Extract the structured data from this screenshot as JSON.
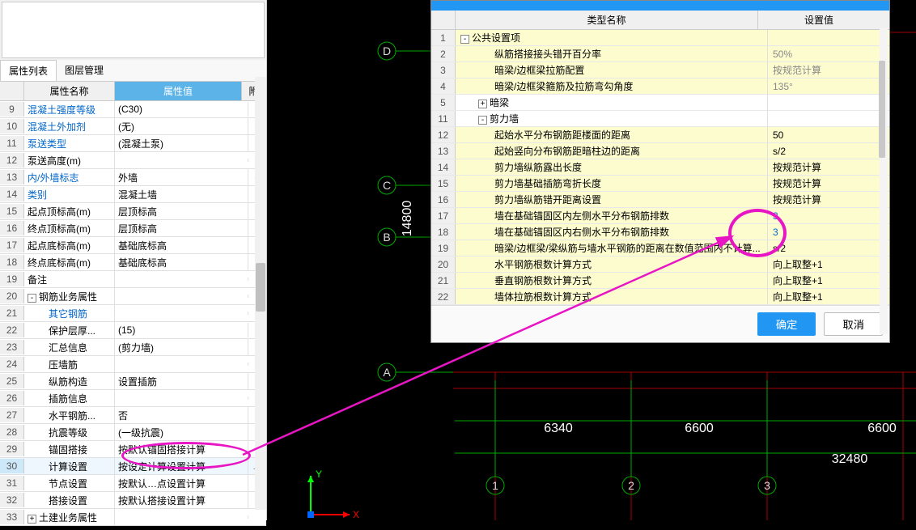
{
  "leftPanel": {
    "tabs": {
      "a": "属性列表",
      "b": "图层管理"
    },
    "header": {
      "name": "属性名称",
      "val": "属性值",
      "ext": "附"
    },
    "rows": [
      {
        "n": "9",
        "name": "混凝土强度等级",
        "val": "(C30)",
        "link": true,
        "ind": 0,
        "ext": "("
      },
      {
        "n": "10",
        "name": "混凝土外加剂",
        "val": "(无)",
        "link": true,
        "ind": 0,
        "ext": ""
      },
      {
        "n": "11",
        "name": "泵送类型",
        "val": "(混凝土泵)",
        "link": true,
        "ind": 0,
        "ext": ""
      },
      {
        "n": "12",
        "name": "泵送高度(m)",
        "val": "",
        "link": false,
        "ind": 0,
        "ext": ""
      },
      {
        "n": "13",
        "name": "内/外墙标志",
        "val": "外墙",
        "link": true,
        "ind": 0,
        "ext": "✓"
      },
      {
        "n": "14",
        "name": "类别",
        "val": "混凝土墙",
        "link": true,
        "ind": 0,
        "ext": "("
      },
      {
        "n": "15",
        "name": "起点顶标高(m)",
        "val": "层顶标高",
        "link": false,
        "ind": 0,
        "ext": "("
      },
      {
        "n": "16",
        "name": "终点顶标高(m)",
        "val": "层顶标高",
        "link": false,
        "ind": 0,
        "ext": "("
      },
      {
        "n": "17",
        "name": "起点底标高(m)",
        "val": "基础底标高",
        "link": false,
        "ind": 0,
        "ext": "("
      },
      {
        "n": "18",
        "name": "终点底标高(m)",
        "val": "基础底标高",
        "link": false,
        "ind": 0,
        "ext": "("
      },
      {
        "n": "19",
        "name": "备注",
        "val": "",
        "link": false,
        "ind": 0,
        "ext": "("
      },
      {
        "n": "20",
        "name": "钢筋业务属性",
        "val": "",
        "link": false,
        "ind": 0,
        "ext": "",
        "exp": "-"
      },
      {
        "n": "21",
        "name": "其它钢筋",
        "val": "",
        "link": true,
        "ind": 2,
        "ext": ""
      },
      {
        "n": "22",
        "name": "保护层厚...",
        "val": "(15)",
        "link": false,
        "ind": 2,
        "ext": "("
      },
      {
        "n": "23",
        "name": "汇总信息",
        "val": "(剪力墙)",
        "link": false,
        "ind": 2,
        "ext": "("
      },
      {
        "n": "24",
        "name": "压墙筋",
        "val": "",
        "link": false,
        "ind": 2,
        "ext": "("
      },
      {
        "n": "25",
        "name": "纵筋构造",
        "val": "设置插筋",
        "link": false,
        "ind": 2,
        "ext": "("
      },
      {
        "n": "26",
        "name": "插筋信息",
        "val": "",
        "link": false,
        "ind": 2,
        "ext": "("
      },
      {
        "n": "27",
        "name": "水平钢筋...",
        "val": "否",
        "link": false,
        "ind": 2,
        "ext": "("
      },
      {
        "n": "28",
        "name": "抗震等级",
        "val": "(一级抗震)",
        "link": false,
        "ind": 2,
        "ext": "("
      },
      {
        "n": "29",
        "name": "锚固搭接",
        "val": "按默认锚固搭接计算",
        "link": false,
        "ind": 2,
        "ext": "("
      },
      {
        "n": "30",
        "name": "计算设置",
        "val": "按设定计算设置计算",
        "link": false,
        "ind": 2,
        "ext": "…",
        "sel": true
      },
      {
        "n": "31",
        "name": "节点设置",
        "val": "按默认…点设置计算",
        "link": false,
        "ind": 2,
        "ext": "("
      },
      {
        "n": "32",
        "name": "搭接设置",
        "val": "按默认搭接设置计算",
        "link": false,
        "ind": 2,
        "ext": "("
      },
      {
        "n": "33",
        "name": "土建业务属性",
        "val": "",
        "link": false,
        "ind": 0,
        "ext": "",
        "exp": "+"
      }
    ]
  },
  "dialog": {
    "header": {
      "c1": "类型名称",
      "c2": "设置值"
    },
    "rows": [
      {
        "n": "1",
        "t": "公共设置项",
        "v": "",
        "exp": "-",
        "ind": 0,
        "w": false
      },
      {
        "n": "2",
        "t": "纵筋搭接接头错开百分率",
        "v": "50%",
        "ind": 2,
        "w": false,
        "g": true
      },
      {
        "n": "3",
        "t": "暗梁/边框梁拉筋配置",
        "v": "按规范计算",
        "ind": 2,
        "w": false,
        "g": true
      },
      {
        "n": "4",
        "t": "暗梁/边框梁箍筋及拉筋弯勾角度",
        "v": "135°",
        "ind": 2,
        "w": false,
        "g": true
      },
      {
        "n": "5",
        "t": "暗梁",
        "v": "",
        "exp": "+",
        "ind": 1,
        "w": true
      },
      {
        "n": "11",
        "t": "剪力墙",
        "v": "",
        "exp": "-",
        "ind": 1,
        "w": true
      },
      {
        "n": "12",
        "t": "起始水平分布钢筋距楼面的距离",
        "v": "50",
        "ind": 2,
        "w": false
      },
      {
        "n": "13",
        "t": "起始竖向分布钢筋距暗柱边的距离",
        "v": "s/2",
        "ind": 2,
        "w": false
      },
      {
        "n": "14",
        "t": "剪力墙纵筋露出长度",
        "v": "按规范计算",
        "ind": 2,
        "w": false
      },
      {
        "n": "15",
        "t": "剪力墙基础插筋弯折长度",
        "v": "按规范计算",
        "ind": 2,
        "w": false
      },
      {
        "n": "16",
        "t": "剪力墙纵筋错开距离设置",
        "v": "按规范计算",
        "ind": 2,
        "w": false
      },
      {
        "n": "17",
        "t": "墙在基础锚固区内左侧水平分布钢筋排数",
        "v": "3",
        "ind": 2,
        "w": false,
        "b": true
      },
      {
        "n": "18",
        "t": "墙在基础锚固区内右侧水平分布钢筋排数",
        "v": "3",
        "ind": 2,
        "w": false,
        "b": true
      },
      {
        "n": "19",
        "t": "暗梁/边框梁/梁纵筋与墙水平钢筋的距离在数值范围内不计算...",
        "v": "s/2",
        "ind": 2,
        "w": false
      },
      {
        "n": "20",
        "t": "水平钢筋根数计算方式",
        "v": "向上取整+1",
        "ind": 2,
        "w": false
      },
      {
        "n": "21",
        "t": "垂直钢筋根数计算方式",
        "v": "向上取整+1",
        "ind": 2,
        "w": false
      },
      {
        "n": "22",
        "t": "墙体拉筋根数计算方式",
        "v": "向上取整+1",
        "ind": 2,
        "w": false
      }
    ],
    "ok": "确定",
    "cancel": "取消"
  },
  "cad": {
    "lblA": "A",
    "lblB": "B",
    "lblC": "C",
    "lblD": "D",
    "lbl1": "1",
    "lbl2": "2",
    "lbl3": "3",
    "dim14800": "14800",
    "dim6340": "6340",
    "dim6600a": "6600",
    "dim6600b": "6600",
    "dim32480": "32480",
    "ax_x": "X",
    "ax_y": "Y"
  }
}
